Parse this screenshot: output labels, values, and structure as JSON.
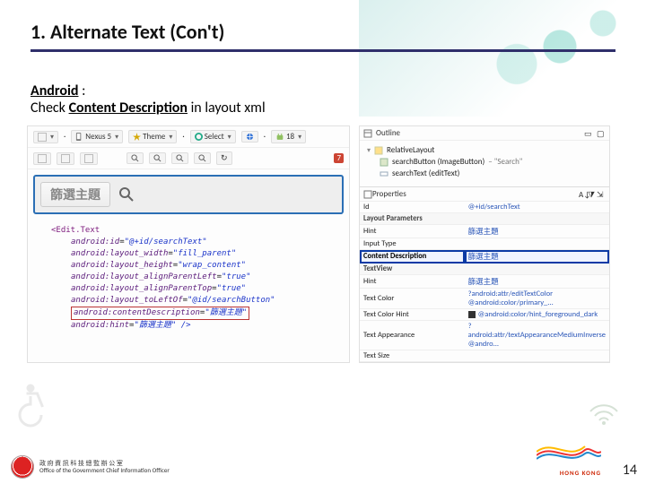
{
  "slide": {
    "title": "1. Alternate Text (Con't)",
    "subtitle_platform": "Android",
    "colon": " :",
    "subtitle_prefix": "Check ",
    "subtitle_key": "Content Description",
    "subtitle_suffix": " in layout xml",
    "page_number": "14"
  },
  "designer": {
    "toolbar": {
      "device": "Nexus 5",
      "appTheme": "Theme",
      "selector": "Select",
      "api": "18",
      "errors": "7"
    },
    "preview": {
      "search_chip": "篩選主題"
    },
    "xml": {
      "tag_open": "<Edit.Text",
      "lines": [
        {
          "attr": "android:id",
          "val": "\"@+id/searchText\""
        },
        {
          "attr": "android:layout_width",
          "val": "\"fill_parent\""
        },
        {
          "attr": "android:layout_height",
          "val": "\"wrap_content\""
        },
        {
          "attr": "android:layout_alignParentLeft",
          "val": "\"true\""
        },
        {
          "attr": "android:layout_alignParentTop",
          "val": "\"true\""
        },
        {
          "attr": "android:layout_toLeftOf",
          "val": "\"@id/searchButton\""
        }
      ],
      "highlight": {
        "attr": "android:contentDescription",
        "val": "\"篩選主題\""
      },
      "hint_attr": "android:hint",
      "hint_val": "\"篩選主題\" />"
    }
  },
  "outline": {
    "panel_label": "Outline",
    "items": [
      {
        "name": "RelativeLayout",
        "detail": ""
      },
      {
        "name": "searchButton (ImageButton)",
        "detail": " – \"Search\""
      },
      {
        "name": "searchText (editText)",
        "detail": ""
      }
    ]
  },
  "properties": {
    "panel_label": "Properties",
    "rows": [
      {
        "k": "Id",
        "v": "@+id/searchText"
      }
    ],
    "section_layout": "Layout Parameters",
    "rows2": [
      {
        "k": "Hint",
        "v": "篩選主題"
      },
      {
        "k": "Input Type",
        "v": ""
      }
    ],
    "highlight": {
      "k": "Content Description",
      "v": "篩選主題"
    },
    "section_textview": "TextView",
    "rows3": [
      {
        "k": "Hint",
        "v": "篩選主題"
      },
      {
        "k": "Text Color",
        "v": "?android:attr/editTextColor @android:color/primary_..."
      },
      {
        "k": "Text Color Hint",
        "v": "@android:color/hint_foreground_dark"
      },
      {
        "k": "Text Appearance",
        "v": "?android:attr/textAppearanceMediumInverse @andro..."
      },
      {
        "k": "Text Size",
        "v": ""
      }
    ]
  },
  "footer": {
    "org_line1": "政 府 資 訊 科 技 總 監 辦 公 室",
    "org_line2": "Office of the Government Chief Information Officer",
    "brand": "HONG KONG"
  }
}
